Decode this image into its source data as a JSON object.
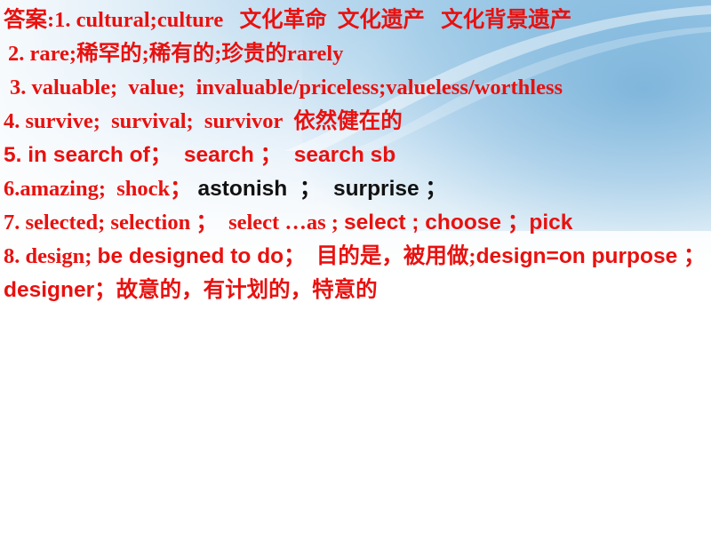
{
  "slide": {
    "background": {
      "type": "gradient",
      "top_color": "#9ec9e8",
      "bottom_color": "#ffffff",
      "accent_color": "#6eacd6"
    },
    "text_colors": {
      "primary_red": "#e8110f",
      "secondary_black": "#111111"
    }
  },
  "answers": {
    "heading_prefix": "答案:",
    "lines": [
      {
        "id": "line-1",
        "indent": "none",
        "segments": [
          {
            "text": "答案:1. cultural;culture   文化革命  文化遗产   文化背景遗产",
            "font": "serif",
            "color": "red"
          }
        ]
      },
      {
        "id": "line-2",
        "indent": "indent-1",
        "segments": [
          {
            "text": "2. rare;稀罕的;稀有的;珍贵的rarely",
            "font": "serif",
            "color": "red"
          }
        ]
      },
      {
        "id": "line-3",
        "indent": "indent-2",
        "segments": [
          {
            "text": "3. valuable;  value;  invaluable/priceless;valueless/worthless",
            "font": "serif",
            "color": "red"
          }
        ]
      },
      {
        "id": "line-4",
        "indent": "none",
        "segments": [
          {
            "text": "4. survive;  survival;  survivor  依然健在的",
            "font": "serif",
            "color": "red"
          }
        ]
      },
      {
        "id": "line-5",
        "indent": "none",
        "segments": [
          {
            "text": "5. in search of；  search ；  search sb",
            "font": "sans",
            "color": "red"
          }
        ]
      },
      {
        "id": "line-6",
        "indent": "none",
        "segments": [
          {
            "text": "6.amazing;  shock；",
            "font": "serif",
            "color": "red"
          },
          {
            "text": " astonish  ；  surprise ；",
            "font": "sans",
            "color": "black"
          }
        ]
      },
      {
        "id": "line-7",
        "indent": "none",
        "segments": [
          {
            "text": "7. selected; selection ；  select …as ; ",
            "font": "serif",
            "color": "red"
          },
          {
            "text": "select ; choose ；pick",
            "font": "sans",
            "color": "red"
          }
        ]
      },
      {
        "id": "line-8",
        "indent": "none",
        "segments": [
          {
            "text": "8. design; ",
            "font": "serif",
            "color": "red"
          },
          {
            "text": "be designed to do",
            "font": "sans",
            "color": "red"
          },
          {
            "text": "；  目的是，被用做;",
            "font": "serif",
            "color": "red"
          },
          {
            "text": "design=on purpose ；    designer",
            "font": "sans",
            "color": "red"
          },
          {
            "text": "；故意的，有计划的，特意的",
            "font": "serif",
            "color": "red"
          }
        ]
      }
    ]
  }
}
